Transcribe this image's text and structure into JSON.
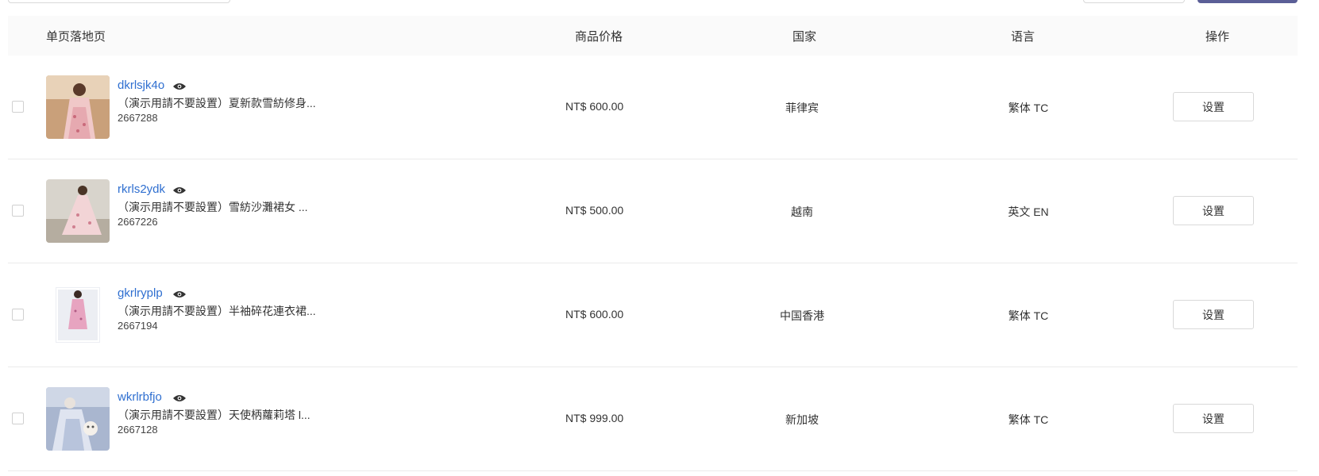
{
  "table": {
    "headers": {
      "page": "单页落地页",
      "price": "商品价格",
      "country": "国家",
      "language": "语言",
      "operation": "操作"
    },
    "rows": [
      {
        "name": "dkrlsjk4o",
        "desc": "（演示用請不要設置）夏新款雪紡修身...",
        "id": "2667288",
        "price": "NT$ 600.00",
        "country": "菲律宾",
        "language": "繁体 TC",
        "action": "设置"
      },
      {
        "name": "rkrls2ydk",
        "desc": "（演示用請不要設置）雪紡沙灘裙女 ...",
        "id": "2667226",
        "price": "NT$ 500.00",
        "country": "越南",
        "language": "英文 EN",
        "action": "设置"
      },
      {
        "name": "gkrlryplp",
        "desc": "（演示用請不要設置）半袖碎花連衣裙...",
        "id": "2667194",
        "price": "NT$ 600.00",
        "country": "中国香港",
        "language": "繁体 TC",
        "action": "设置"
      },
      {
        "name": "wkrlrbfjo",
        "desc": "（演示用請不要設置）天使柄蘿莉塔 l...",
        "id": "2667128",
        "price": "NT$ 999.00",
        "country": "新加坡",
        "language": "繁体 TC",
        "action": "设置"
      }
    ]
  },
  "colors": {
    "link": "#2f6fd0",
    "primary_button": "#5b5f97",
    "header_bg": "#fafafa"
  }
}
